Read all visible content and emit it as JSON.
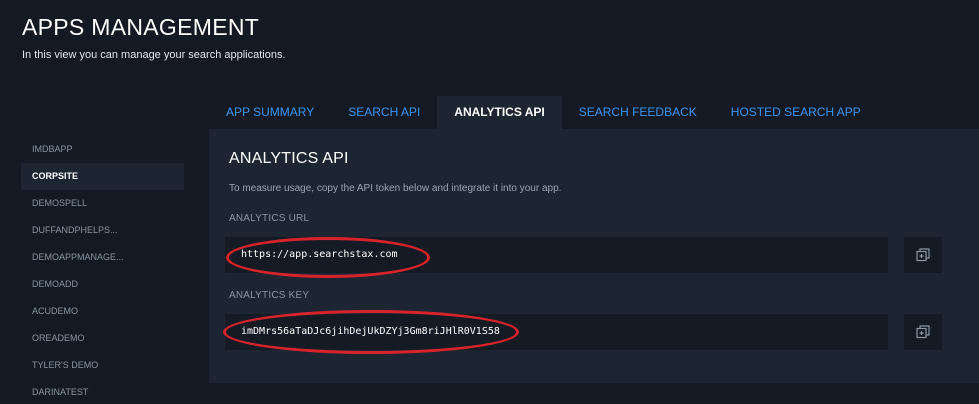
{
  "header": {
    "title": "APPS MANAGEMENT",
    "subtitle": "In this view you can manage your search applications."
  },
  "sidebar": {
    "items": [
      {
        "label": "IMDBAPP"
      },
      {
        "label": "CORPSITE",
        "active": true
      },
      {
        "label": "DEMOSPELL"
      },
      {
        "label": "DUFFANDPHELPS..."
      },
      {
        "label": "DEMOAPPMANAGE..."
      },
      {
        "label": "DEMOADD"
      },
      {
        "label": "ACUDEMO"
      },
      {
        "label": "OREADEMO"
      },
      {
        "label": "TYLER'S DEMO"
      },
      {
        "label": "DARINATEST"
      }
    ]
  },
  "tabs": [
    {
      "label": "APP SUMMARY"
    },
    {
      "label": "SEARCH API"
    },
    {
      "label": "ANALYTICS API",
      "active": true
    },
    {
      "label": "SEARCH FEEDBACK"
    },
    {
      "label": "HOSTED SEARCH APP"
    }
  ],
  "panel": {
    "title": "ANALYTICS API",
    "description": "To measure usage, copy the API token below and integrate it into your app.",
    "url_label": "ANALYTICS URL",
    "url_value": "https://app.searchstax.com",
    "key_label": "ANALYTICS KEY",
    "key_value": "imDMrs56aTaDJc6jihDejUkDZYj3Gm8riJHlR0V1S58"
  },
  "icons": {
    "copy": "copy-icon"
  },
  "colors": {
    "background": "#131a23",
    "panel": "#1c2531",
    "input": "#141b24",
    "accent": "#3b95f0",
    "annotation": "#d9232b"
  }
}
